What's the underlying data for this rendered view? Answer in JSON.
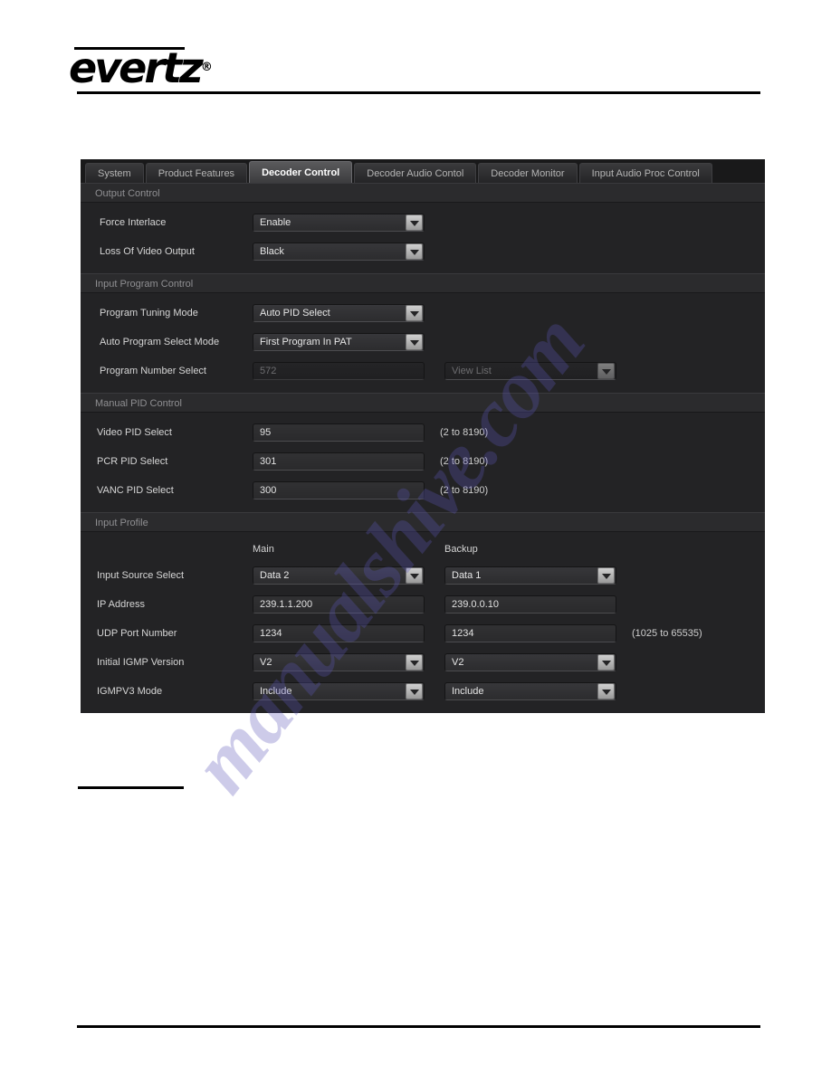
{
  "page": {
    "brand": "evertz",
    "registered_mark": "®"
  },
  "tabs": [
    {
      "label": "System",
      "active": false
    },
    {
      "label": "Product Features",
      "active": false
    },
    {
      "label": "Decoder Control",
      "active": true
    },
    {
      "label": "Decoder Audio Contol",
      "active": false
    },
    {
      "label": "Decoder Monitor",
      "active": false
    },
    {
      "label": "Input Audio Proc Control",
      "active": false
    }
  ],
  "sections": {
    "output_control": {
      "title": "Output Control",
      "rows": [
        {
          "label": "Force Interlace",
          "value": "Enable",
          "control": "dropdown"
        },
        {
          "label": "Loss Of Video Output",
          "value": "Black",
          "control": "dropdown"
        }
      ]
    },
    "input_program_control": {
      "title": "Input Program Control",
      "rows": [
        {
          "label": "Program Tuning Mode",
          "value": "Auto PID Select",
          "control": "dropdown",
          "disabled": false
        },
        {
          "label": "Auto Program Select Mode",
          "value": "First Program In PAT",
          "control": "dropdown",
          "disabled": false
        },
        {
          "label": "Program Number Select",
          "value": "572",
          "control": "textbox",
          "disabled": true,
          "secondary": {
            "value": "View List",
            "control": "dropdown",
            "disabled": true
          }
        }
      ]
    },
    "manual_pid_control": {
      "title": "Manual PID Control",
      "rows": [
        {
          "label": "Video PID Select",
          "value": "95",
          "control": "textbox",
          "hint": "(2 to 8190)"
        },
        {
          "label": "PCR PID Select",
          "value": "301",
          "control": "textbox",
          "hint": "(2 to 8190)"
        },
        {
          "label": "VANC PID Select",
          "value": "300",
          "control": "textbox",
          "hint": "(2 to 8190)"
        }
      ]
    },
    "input_profile": {
      "title": "Input Profile",
      "column_headers": {
        "main": "Main",
        "backup": "Backup"
      },
      "rows": [
        {
          "label": "Input Source Select",
          "main": "Data 2",
          "backup": "Data 1",
          "control": "dropdown",
          "hint": ""
        },
        {
          "label": "IP Address",
          "main": "239.1.1.200",
          "backup": "239.0.0.10",
          "control": "textbox",
          "hint": ""
        },
        {
          "label": "UDP Port Number",
          "main": "1234",
          "backup": "1234",
          "control": "textbox",
          "hint": "(1025 to 65535)"
        },
        {
          "label": "Initial IGMP Version",
          "main": "V2",
          "backup": "V2",
          "control": "dropdown",
          "hint": ""
        },
        {
          "label": "IGMPV3 Mode",
          "main": "Include",
          "backup": "Include",
          "control": "dropdown",
          "hint": ""
        }
      ]
    }
  },
  "watermark": {
    "text": "manualshive.com"
  }
}
